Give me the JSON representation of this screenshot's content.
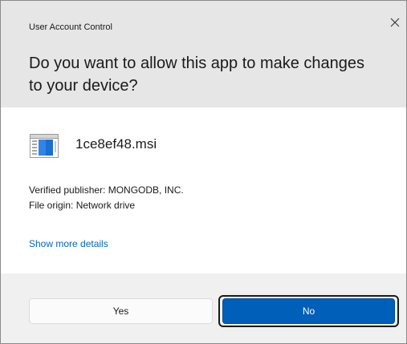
{
  "dialog": {
    "title": "User Account Control",
    "question": "Do you want to allow this app to make changes to your device?",
    "app_name": "1ce8ef48.msi",
    "publisher": "Verified publisher: MONGODB, INC.",
    "origin": "File origin: Network drive",
    "details_link": "Show more details",
    "yes_label": "Yes",
    "no_label": "No"
  },
  "icons": {
    "close": "close-icon",
    "app": "installer-package-icon"
  },
  "colors": {
    "header_bg": "#e6e6e6",
    "footer_bg": "#f0f0f0",
    "accent": "#005fb8",
    "link": "#0067c0"
  }
}
